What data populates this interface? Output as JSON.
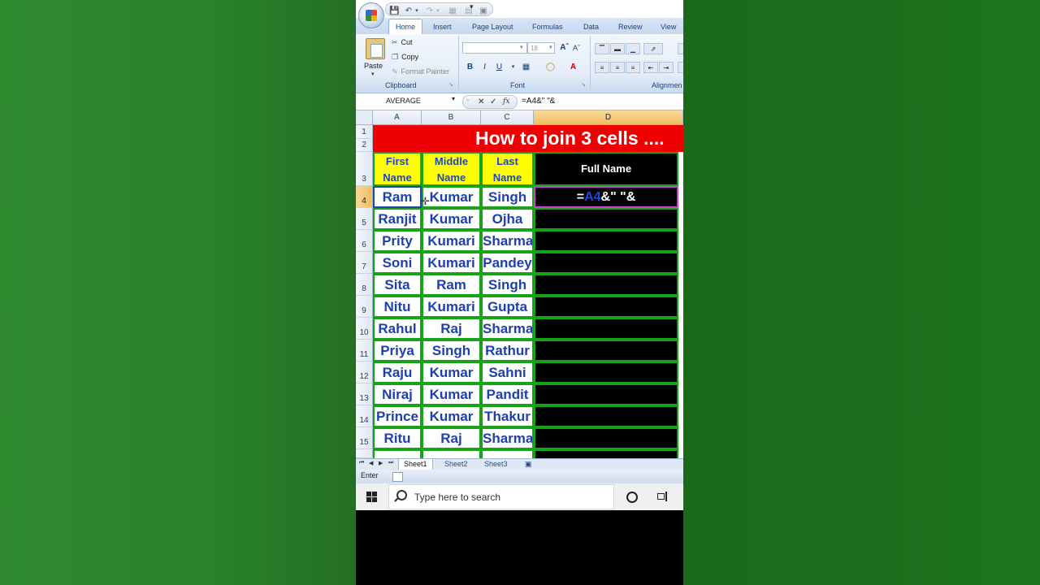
{
  "quick_access": {
    "icons": [
      "save-icon",
      "undo-icon",
      "redo-icon",
      "customize-icon"
    ]
  },
  "tabs": [
    "Home",
    "Insert",
    "Page Layout",
    "Formulas",
    "Data",
    "Review",
    "View"
  ],
  "ribbon": {
    "paste_label": "Paste",
    "cut_label": "Cut",
    "copy_label": "Copy",
    "format_painter_label": "Format Painter",
    "clipboard_group": "Clipboard",
    "font_group": "Font",
    "alignment_group": "Alignmen",
    "font_size": "18"
  },
  "formula_bar": {
    "name_box": "AVERAGE",
    "formula": "=A4&\" \"&"
  },
  "columns": [
    "A",
    "B",
    "C",
    "D"
  ],
  "rows": [
    "1",
    "2",
    "3",
    "4",
    "5",
    "6",
    "7",
    "8",
    "9",
    "10",
    "11",
    "12",
    "13",
    "14",
    "15"
  ],
  "banner": "How to join  3 cells ....",
  "headers": {
    "first": [
      "First",
      "Name"
    ],
    "middle": [
      "Middle",
      "Name"
    ],
    "last": [
      "Last",
      "Name"
    ],
    "full": "Full Name"
  },
  "table": [
    [
      "Ram",
      "Kumar",
      "Singh"
    ],
    [
      "Ranjit",
      "Kumar",
      "Ojha"
    ],
    [
      "Prity",
      "Kumari",
      "Sharma"
    ],
    [
      "Soni",
      "Kumari",
      "Pandey"
    ],
    [
      "Sita",
      "Ram",
      "Singh"
    ],
    [
      "Nitu",
      "Kumari",
      "Gupta"
    ],
    [
      "Rahul",
      "Raj",
      "Sharma"
    ],
    [
      "Priya",
      "Singh",
      "Rathur"
    ],
    [
      "Raju",
      "Kumar",
      "Sahni"
    ],
    [
      "Niraj",
      "Kumar",
      "Pandit"
    ],
    [
      "Prince",
      "Kumar",
      "Thakur"
    ],
    [
      "Ritu",
      "Raj",
      "Sharma"
    ]
  ],
  "editing_cell": {
    "eq": "=",
    "ref": "A4",
    "rest": "&\" \"&"
  },
  "sheets": [
    "Sheet1",
    "Sheet2",
    "Sheet3"
  ],
  "status": "Enter",
  "taskbar": {
    "search_placeholder": "Type here to search"
  }
}
